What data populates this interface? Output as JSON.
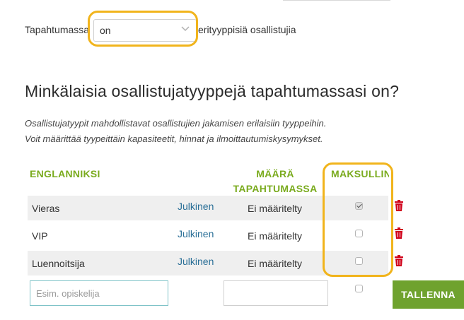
{
  "sentence": {
    "prefix": "Tapahtumassa",
    "selected_value": "on",
    "suffix": "erityyppisiä osallistujia"
  },
  "section": {
    "heading": "Minkälaisia osallistujatyyppejä tapahtumassasi on?",
    "description_line1": "Osallistujatyypit mahdollistavat osallistujien jakamisen erilaisiin tyyppeihin.",
    "description_line2": "Voit määrittää tyypeittäin kapasiteetit, hinnat ja ilmoittautumiskysymykset."
  },
  "table": {
    "headers": {
      "language": "ENGLANNIKSI",
      "amount": "MÄÄRÄ TAPAHTUMASSA",
      "paid": "MAKSULLINEN"
    },
    "rows": [
      {
        "name": "Vieras",
        "visibility": "Julkinen",
        "amount": "Ei määritelty",
        "paid": true
      },
      {
        "name": "VIP",
        "visibility": "Julkinen",
        "amount": "Ei määritelty",
        "paid": false
      },
      {
        "name": "Luennoitsija",
        "visibility": "Julkinen",
        "amount": "Ei määritelty",
        "paid": false
      }
    ]
  },
  "new_row": {
    "name_placeholder": "Esim. opiskelija",
    "amount_value": "",
    "save_label": "TALLENNA"
  },
  "colors": {
    "accent_green": "#7aab1e",
    "highlight": "#f1b41c",
    "link": "#2a6f97",
    "delete": "#d0021b"
  },
  "icons": {
    "dropdown": "chevron-down-icon",
    "delete": "trash-icon"
  }
}
